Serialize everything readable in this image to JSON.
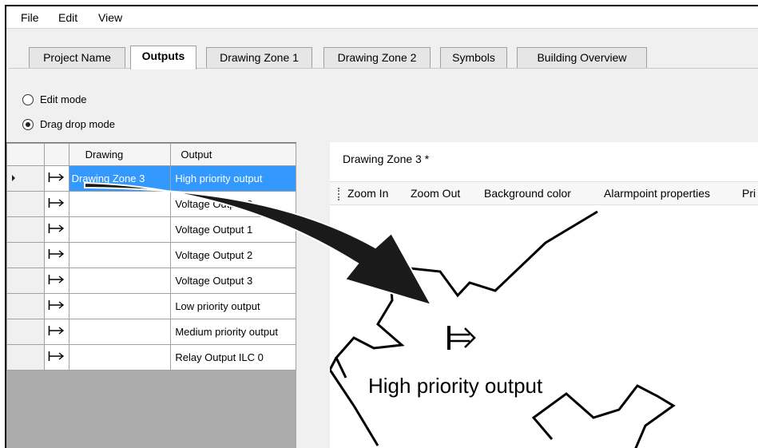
{
  "menubar": {
    "items": [
      "File",
      "Edit",
      "View"
    ]
  },
  "tabs": [
    {
      "label": "Project Name",
      "active": false
    },
    {
      "label": "Outputs",
      "active": true
    },
    {
      "label": "Drawing Zone 1",
      "active": false
    },
    {
      "label": "Drawing Zone 2",
      "active": false
    },
    {
      "label": "Symbols",
      "active": false
    },
    {
      "label": "Building Overview",
      "active": false
    }
  ],
  "modes": {
    "edit_label": "Edit mode",
    "drag_label": "Drag drop mode",
    "selected": "drag"
  },
  "grid": {
    "headers": [
      "Drawing",
      "Output"
    ],
    "rows": [
      {
        "drawing": "Drawing Zone 3",
        "output": "High priority output",
        "selected": true
      },
      {
        "drawing": "",
        "output": "Voltage Output 0",
        "selected": false
      },
      {
        "drawing": "",
        "output": "Voltage Output 1",
        "selected": false
      },
      {
        "drawing": "",
        "output": "Voltage Output 2",
        "selected": false
      },
      {
        "drawing": "",
        "output": "Voltage Output 3",
        "selected": false
      },
      {
        "drawing": "",
        "output": "Low priority output",
        "selected": false
      },
      {
        "drawing": "",
        "output": "Medium priority output",
        "selected": false
      },
      {
        "drawing": "",
        "output": "Relay Output ILC 0",
        "selected": false
      }
    ]
  },
  "drawing_panel": {
    "title": "Drawing Zone 3 *",
    "toolbar": [
      "Zoom In",
      "Zoom Out",
      "Background color",
      "Alarmpoint properties",
      "Pri"
    ],
    "canvas_label": "High priority output"
  },
  "colors": {
    "selection": "#3399ff",
    "grid_bg": "#ababab"
  }
}
